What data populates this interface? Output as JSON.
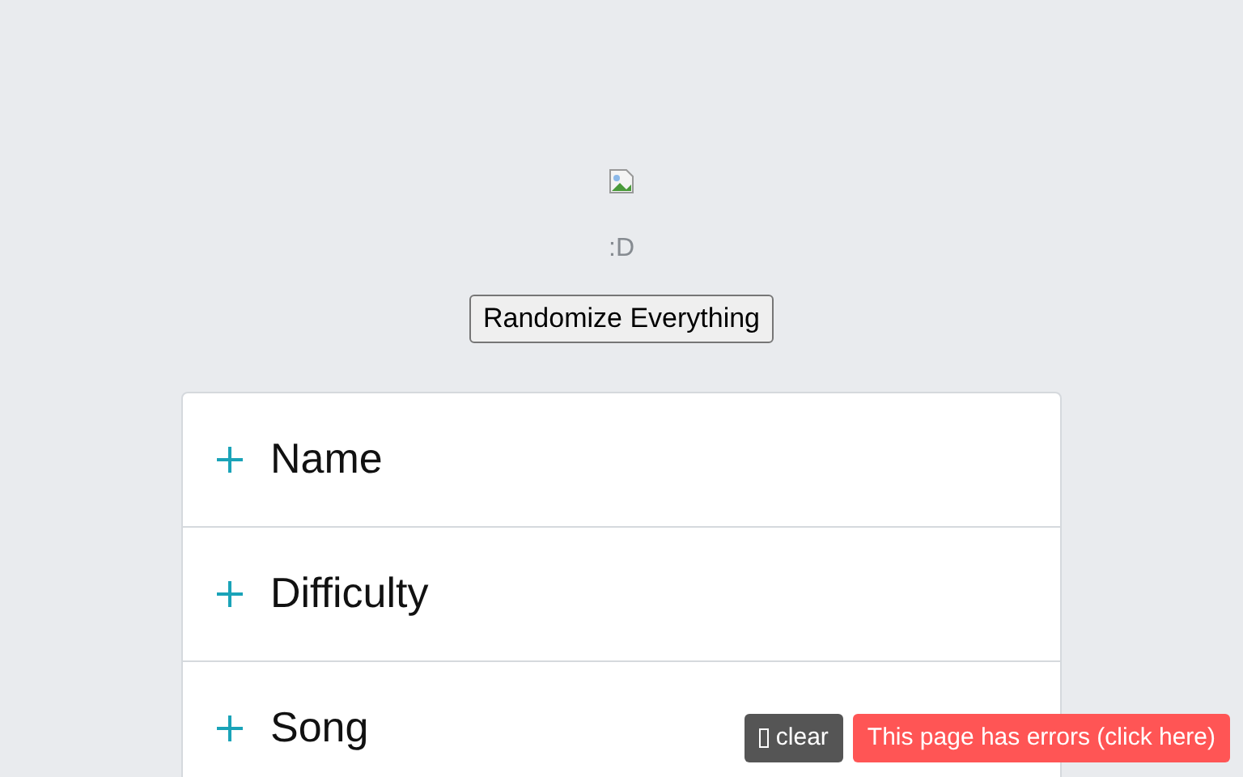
{
  "caption": ":D",
  "randomize_button": "Randomize Everything",
  "sections": [
    {
      "title": "Name",
      "expanded": false
    },
    {
      "title": "Difficulty",
      "expanded": false
    },
    {
      "title": "Song",
      "expanded": false
    }
  ],
  "clear_button": "clear",
  "error_button": "This page has errors (click here)"
}
